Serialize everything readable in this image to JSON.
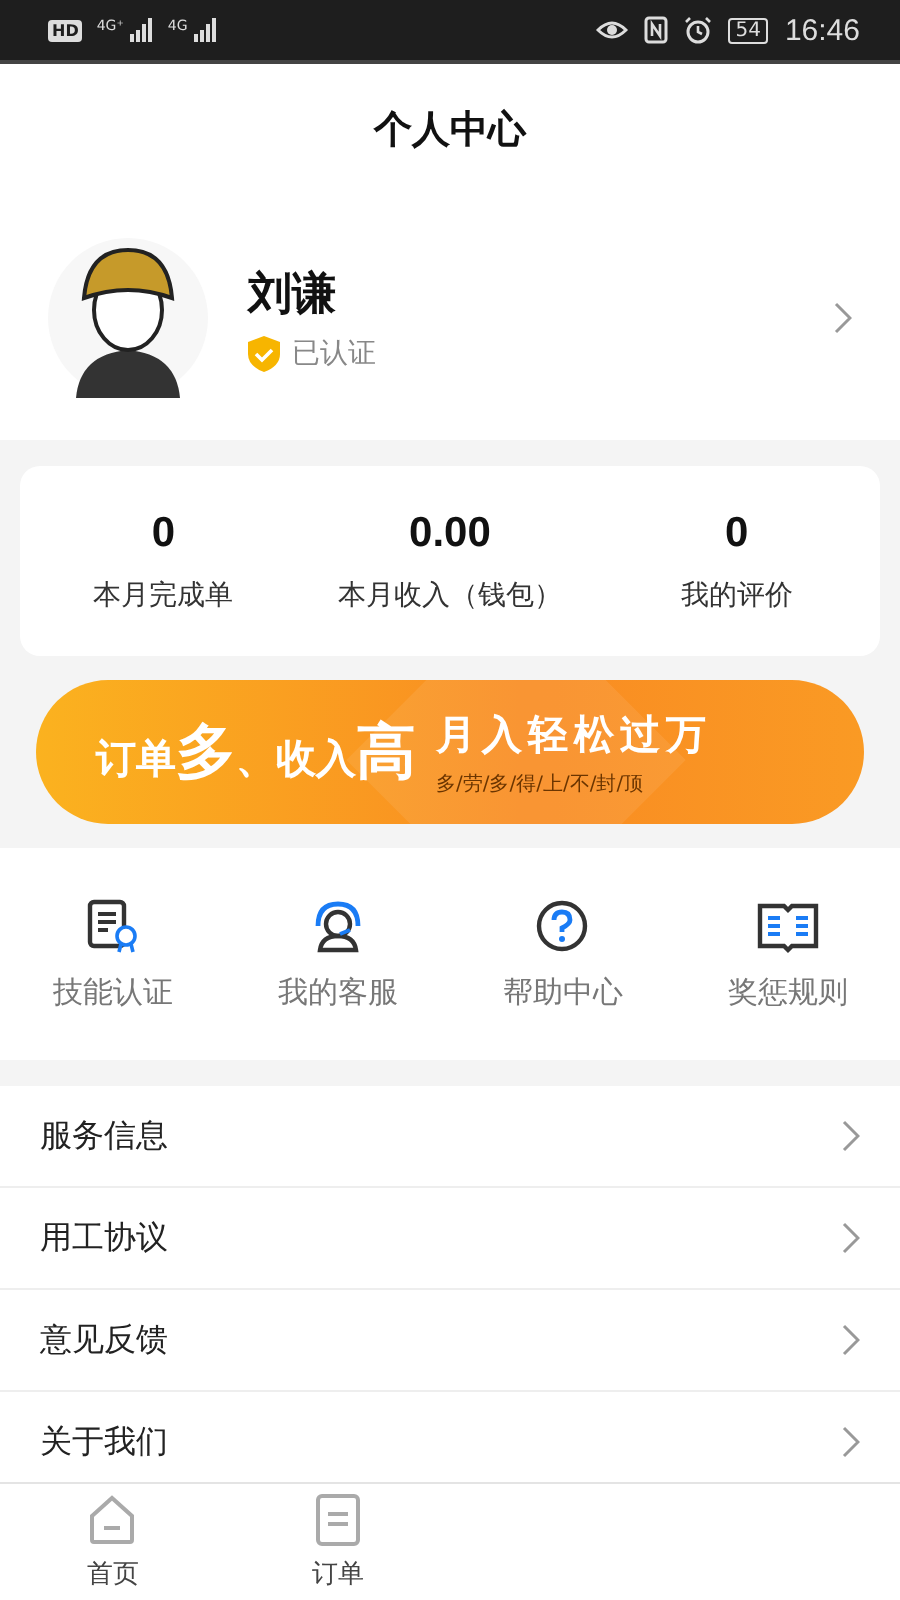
{
  "status_bar": {
    "left": [
      "HD",
      "4G⁺",
      "4G"
    ],
    "battery": "54",
    "time": "16:46"
  },
  "header": {
    "title": "个人中心"
  },
  "profile": {
    "name": "刘谦",
    "verified": true,
    "verified_label": "已认证"
  },
  "stats": [
    {
      "value": "0",
      "label": "本月完成单"
    },
    {
      "value": "0.00",
      "label": "本月收入（钱包）"
    },
    {
      "value": "0",
      "label": "我的评价"
    }
  ],
  "banner": {
    "headline_parts": [
      {
        "text": "订单",
        "big": false
      },
      {
        "text": "多",
        "big": true
      },
      {
        "text": "、收入",
        "big": false
      },
      {
        "text": "高",
        "big": true
      }
    ],
    "slogan": "月入轻松过万",
    "tagline": "多/劳/多/得/上/不/封/顶"
  },
  "shortcuts": [
    {
      "label": "技能认证",
      "kind": "certificate"
    },
    {
      "label": "我的客服",
      "kind": "support"
    },
    {
      "label": "帮助中心",
      "kind": "help"
    },
    {
      "label": "奖惩规则",
      "kind": "book"
    }
  ],
  "menu": [
    "服务信息",
    "用工协议",
    "意见反馈",
    "关于我们"
  ],
  "tab_bar": [
    {
      "label": "首页",
      "kind": "home"
    },
    {
      "label": "订单",
      "kind": "orders"
    }
  ]
}
